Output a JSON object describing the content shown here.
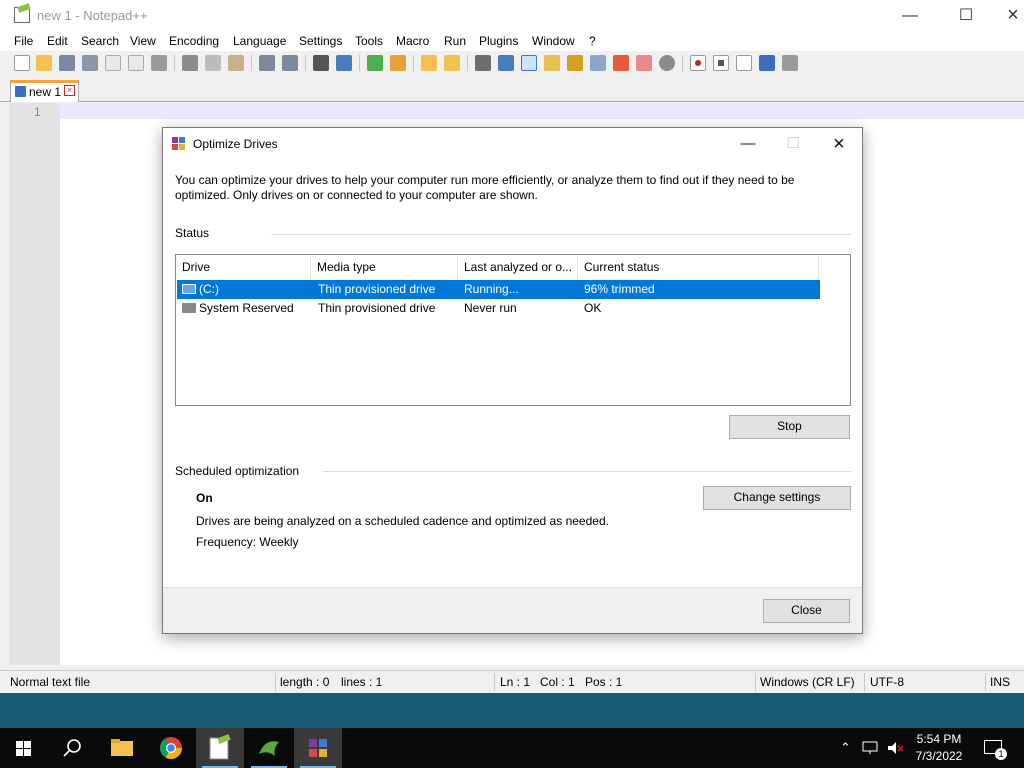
{
  "npp": {
    "window_title": "new 1 - Notepad++",
    "menu": [
      "File",
      "Edit",
      "Search",
      "View",
      "Encoding",
      "Language",
      "Settings",
      "Tools",
      "Macro",
      "Run",
      "Plugins",
      "Window",
      "?"
    ],
    "tab_label": "new 1",
    "line_number": "1",
    "status": {
      "file_type": "Normal text file",
      "length": "length : 0",
      "lines": "lines : 1",
      "ln": "Ln : 1",
      "col": "Col : 1",
      "pos": "Pos : 1",
      "eol": "Windows (CR LF)",
      "encoding": "UTF-8",
      "mode": "INS"
    }
  },
  "dialog": {
    "title": "Optimize Drives",
    "description": "You can optimize your drives to help your computer run more efficiently, or analyze them to find out if they need to be optimized. Only drives on or connected to your computer are shown.",
    "status_label": "Status",
    "columns": [
      "Drive",
      "Media type",
      "Last analyzed or o...",
      "Current status"
    ],
    "drives": [
      {
        "drive": "(C:)",
        "media": "Thin provisioned drive",
        "last": "Running...",
        "status": "96% trimmed",
        "selected": true
      },
      {
        "drive": "System Reserved",
        "media": "Thin provisioned drive",
        "last": "Never run",
        "status": "OK",
        "selected": false
      }
    ],
    "stop_label": "Stop",
    "scheduled_label": "Scheduled optimization",
    "schedule_state": "On",
    "schedule_desc": "Drives are being analyzed on a scheduled cadence and optimized as needed.",
    "frequency": "Frequency: Weekly",
    "change_settings_label": "Change settings",
    "close_label": "Close"
  },
  "taskbar": {
    "time": "5:54 PM",
    "date": "7/3/2022",
    "notification_count": "1"
  },
  "colors": {
    "selection": "#0078d7",
    "desktop": "#1b5a73",
    "npp_tab_accent": "#f7a23c"
  }
}
